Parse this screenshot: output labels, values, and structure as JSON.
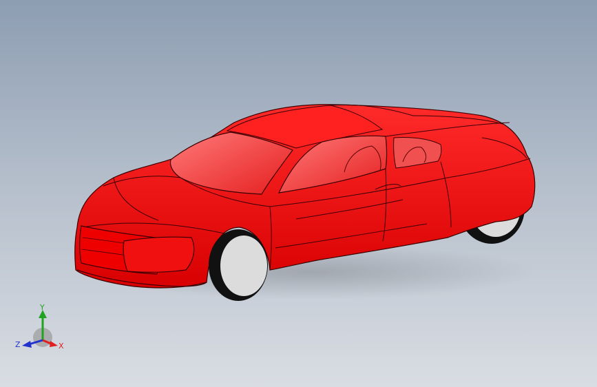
{
  "viewport": {
    "background_top": "#8d9db2",
    "background_bottom": "#d9dde3"
  },
  "model": {
    "body_color": "#ff0000",
    "edge_color": "#3a0000",
    "glass_color": "#f24a4a",
    "tire_color": "#111111",
    "rim_color": "#dcdcdc"
  },
  "triad": {
    "x_label": "X",
    "y_label": "Y",
    "z_label": "Z",
    "x_color": "#e02020",
    "y_color": "#21a321",
    "z_color": "#2233cc"
  }
}
